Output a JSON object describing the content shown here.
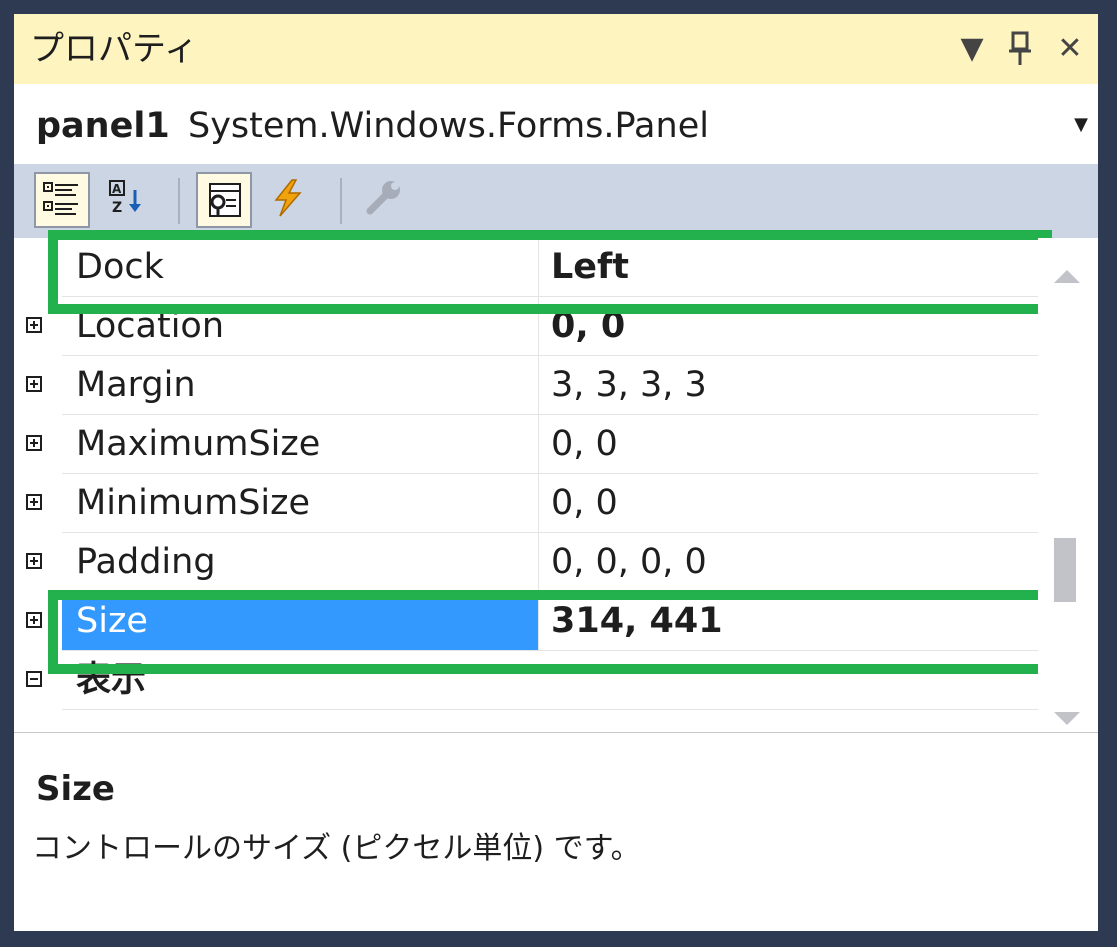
{
  "window": {
    "title": "プロパティ",
    "dropdown_glyph": "▼",
    "pin_glyph": "⊥",
    "close_glyph": "✕"
  },
  "object_selector": {
    "name": "panel1",
    "type": "System.Windows.Forms.Panel"
  },
  "toolbar": {
    "buttons": [
      "categorized-icon",
      "alphabetical-icon",
      "properties-icon",
      "events-icon",
      "property-pages-icon"
    ]
  },
  "properties": [
    {
      "name": "Dock",
      "value": "Left",
      "bold": true,
      "expandable": false
    },
    {
      "name": "Location",
      "value": "0, 0",
      "bold": true,
      "expandable": true
    },
    {
      "name": "Margin",
      "value": "3, 3, 3, 3",
      "bold": false,
      "expandable": true
    },
    {
      "name": "MaximumSize",
      "value": "0, 0",
      "bold": false,
      "expandable": true
    },
    {
      "name": "MinimumSize",
      "value": "0, 0",
      "bold": false,
      "expandable": true
    },
    {
      "name": "Padding",
      "value": "0, 0, 0, 0",
      "bold": false,
      "expandable": true
    },
    {
      "name": "Size",
      "value": "314, 441",
      "bold": true,
      "expandable": true,
      "selected": true
    }
  ],
  "category": {
    "name": "表示"
  },
  "description": {
    "title": "Size",
    "text": "コントロールのサイズ (ピクセル単位) です。"
  },
  "colors": {
    "titlebar": "#fdf4bf",
    "toolbar": "#ccd5e4",
    "selection": "#3399ff",
    "highlight": "#22b14c",
    "frame": "#2d3a52"
  }
}
